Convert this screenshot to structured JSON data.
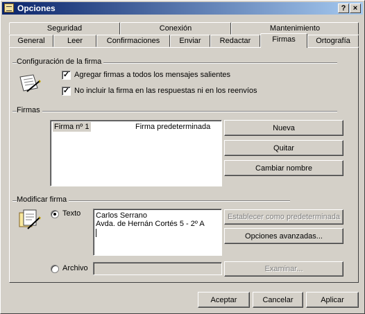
{
  "window": {
    "title": "Opciones",
    "help_label": "?",
    "close_label": "×"
  },
  "tabs_back": [
    {
      "label": "Seguridad"
    },
    {
      "label": "Conexión"
    },
    {
      "label": "Mantenimiento"
    }
  ],
  "tabs_front": [
    {
      "label": "General"
    },
    {
      "label": "Leer"
    },
    {
      "label": "Confirmaciones"
    },
    {
      "label": "Enviar"
    },
    {
      "label": "Redactar"
    },
    {
      "label": "Firmas",
      "active": true
    },
    {
      "label": "Ortografía"
    }
  ],
  "config": {
    "group_label": "Configuración de la firma",
    "add_signatures": {
      "label": "Agregar firmas a todos los mensajes salientes",
      "checked": true
    },
    "no_include_replies": {
      "label": "No incluir la firma en las respuestas ni en los reenvíos",
      "checked": true
    }
  },
  "signatures": {
    "group_label": "Firmas",
    "list": [
      {
        "name": "Firma nº 1",
        "status": "Firma predeterminada",
        "selected": true
      }
    ],
    "new_button": "Nueva",
    "remove_button": "Quitar",
    "rename_button": "Cambiar nombre"
  },
  "edit": {
    "group_label": "Modificar firma",
    "text_option": "Texto",
    "file_option": "Archivo",
    "selected_option": "Texto",
    "text_lines": [
      "Carlos Serrano",
      "Avda. de Hernán Cortés 5 - 2º A"
    ],
    "file_path": "",
    "set_default_button": "Establecer como predeterminada",
    "advanced_button": "Opciones avanzadas...",
    "browse_button": "Examinar..."
  },
  "footer": {
    "accept_button": "Aceptar",
    "cancel_button": "Cancelar",
    "apply_button": "Aplicar"
  }
}
